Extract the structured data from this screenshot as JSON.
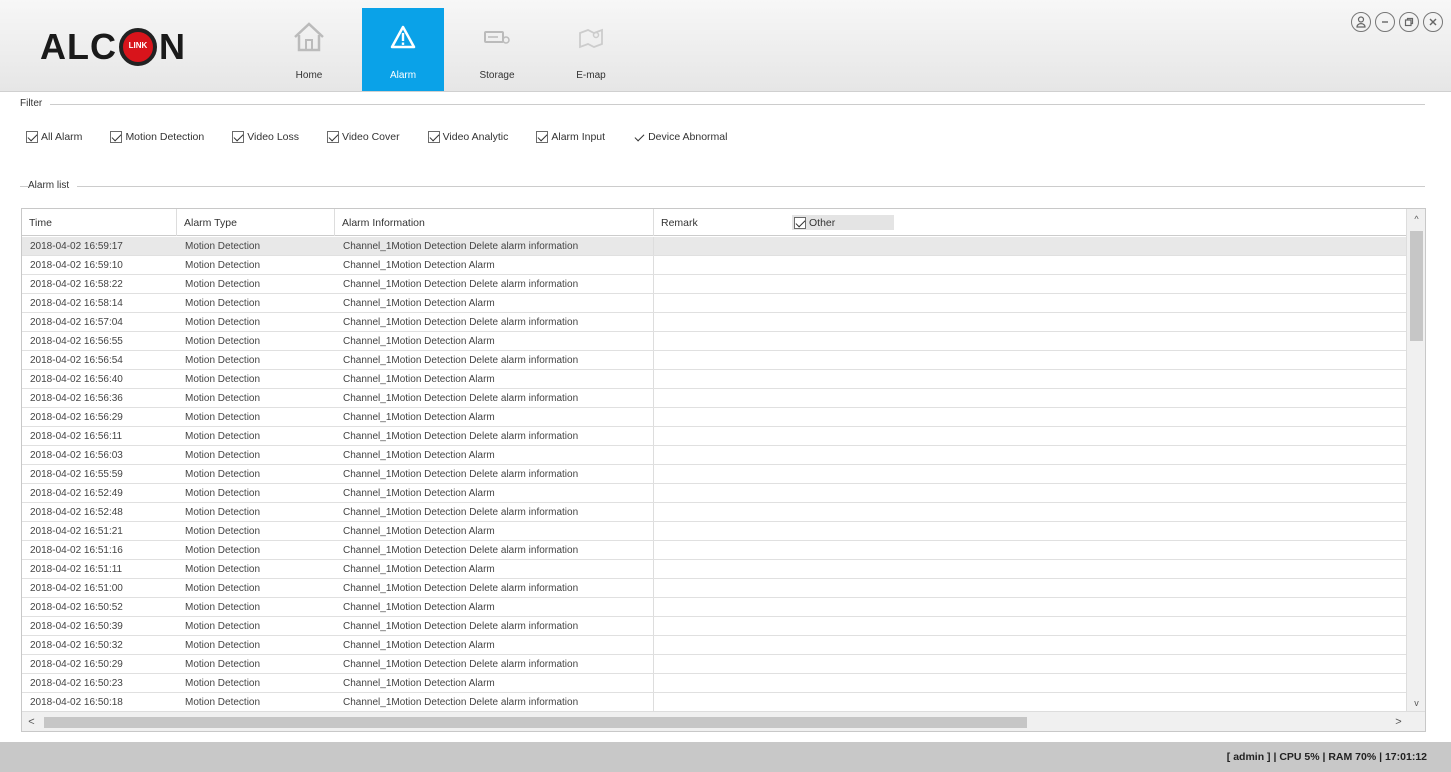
{
  "header": {
    "logo_left": "ALC",
    "logo_badge": "LINK",
    "logo_right": "N",
    "nav": [
      {
        "label": "Home",
        "icon": "home-icon"
      },
      {
        "label": "Alarm",
        "icon": "alarm-warning-icon",
        "active": true
      },
      {
        "label": "Storage",
        "icon": "storage-drive-icon"
      },
      {
        "label": "E-map",
        "icon": "emap-icon"
      }
    ],
    "window_controls": [
      "user-icon",
      "minimize-icon",
      "restore-icon",
      "close-icon"
    ]
  },
  "filter": {
    "legend": "Filter",
    "options": [
      {
        "label": "All Alarm",
        "checked": true
      },
      {
        "label": "Motion Detection",
        "checked": true
      },
      {
        "label": "Video Loss",
        "checked": true
      },
      {
        "label": "Video Cover",
        "checked": true
      },
      {
        "label": "Video Analytic",
        "checked": true
      },
      {
        "label": "Alarm Input",
        "checked": true
      },
      {
        "label": "Device Abnormal",
        "checked": true
      }
    ]
  },
  "alarm_list": {
    "legend": "Alarm list",
    "columns": [
      "Time",
      "Alarm Type",
      "Alarm Information",
      "Remark"
    ],
    "other_label": "Other",
    "rows": [
      [
        "2018-04-02 16:59:17",
        "Motion Detection",
        "Channel_1Motion Detection Delete alarm information"
      ],
      [
        "2018-04-02 16:59:10",
        "Motion Detection",
        "Channel_1Motion Detection Alarm"
      ],
      [
        "2018-04-02 16:58:22",
        "Motion Detection",
        "Channel_1Motion Detection Delete alarm information"
      ],
      [
        "2018-04-02 16:58:14",
        "Motion Detection",
        "Channel_1Motion Detection Alarm"
      ],
      [
        "2018-04-02 16:57:04",
        "Motion Detection",
        "Channel_1Motion Detection Delete alarm information"
      ],
      [
        "2018-04-02 16:56:55",
        "Motion Detection",
        "Channel_1Motion Detection Alarm"
      ],
      [
        "2018-04-02 16:56:54",
        "Motion Detection",
        "Channel_1Motion Detection Delete alarm information"
      ],
      [
        "2018-04-02 16:56:40",
        "Motion Detection",
        "Channel_1Motion Detection Alarm"
      ],
      [
        "2018-04-02 16:56:36",
        "Motion Detection",
        "Channel_1Motion Detection Delete alarm information"
      ],
      [
        "2018-04-02 16:56:29",
        "Motion Detection",
        "Channel_1Motion Detection Alarm"
      ],
      [
        "2018-04-02 16:56:11",
        "Motion Detection",
        "Channel_1Motion Detection Delete alarm information"
      ],
      [
        "2018-04-02 16:56:03",
        "Motion Detection",
        "Channel_1Motion Detection Alarm"
      ],
      [
        "2018-04-02 16:55:59",
        "Motion Detection",
        "Channel_1Motion Detection Delete alarm information"
      ],
      [
        "2018-04-02 16:52:49",
        "Motion Detection",
        "Channel_1Motion Detection Alarm"
      ],
      [
        "2018-04-02 16:52:48",
        "Motion Detection",
        "Channel_1Motion Detection Delete alarm information"
      ],
      [
        "2018-04-02 16:51:21",
        "Motion Detection",
        "Channel_1Motion Detection Alarm"
      ],
      [
        "2018-04-02 16:51:16",
        "Motion Detection",
        "Channel_1Motion Detection Delete alarm information"
      ],
      [
        "2018-04-02 16:51:11",
        "Motion Detection",
        "Channel_1Motion Detection Alarm"
      ],
      [
        "2018-04-02 16:51:00",
        "Motion Detection",
        "Channel_1Motion Detection Delete alarm information"
      ],
      [
        "2018-04-02 16:50:52",
        "Motion Detection",
        "Channel_1Motion Detection Alarm"
      ],
      [
        "2018-04-02 16:50:39",
        "Motion Detection",
        "Channel_1Motion Detection Delete alarm information"
      ],
      [
        "2018-04-02 16:50:32",
        "Motion Detection",
        "Channel_1Motion Detection Alarm"
      ],
      [
        "2018-04-02 16:50:29",
        "Motion Detection",
        "Channel_1Motion Detection Delete alarm information"
      ],
      [
        "2018-04-02 16:50:23",
        "Motion Detection",
        "Channel_1Motion Detection Alarm"
      ],
      [
        "2018-04-02 16:50:18",
        "Motion Detection",
        "Channel_1Motion Detection Delete alarm information"
      ]
    ]
  },
  "status": {
    "text": "[ admin ] | CPU  5% | RAM 70% | 17:01:12"
  },
  "colors": {
    "accent": "#0aa2e8",
    "logo_red": "#d8141b",
    "statusbar": "#c8c8c8"
  }
}
